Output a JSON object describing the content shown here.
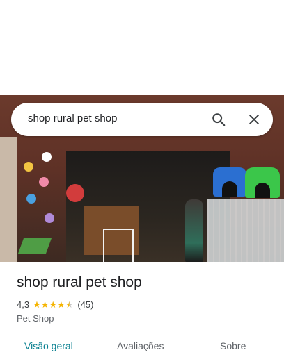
{
  "search": {
    "query": "shop rural pet shop"
  },
  "icons": {
    "search": "search-icon",
    "close": "close-icon"
  },
  "place": {
    "name": "shop rural pet shop",
    "rating": "4,3",
    "stars": 4.3,
    "review_count": "(45)",
    "category": "Pet Shop"
  },
  "tabs": [
    {
      "label": "Visão geral",
      "active": true
    },
    {
      "label": "Avaliações",
      "active": false
    },
    {
      "label": "Sobre",
      "active": false
    }
  ],
  "colors": {
    "accent": "#0b8191",
    "star": "#f5b400"
  }
}
